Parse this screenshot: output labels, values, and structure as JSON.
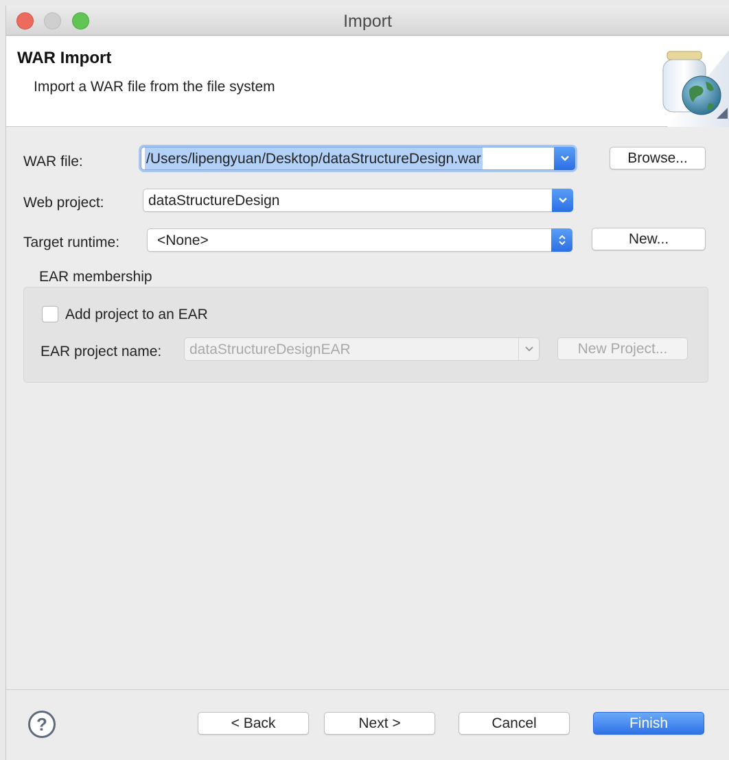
{
  "window": {
    "title": "Import",
    "controls": [
      "close",
      "minimize",
      "zoom"
    ]
  },
  "banner": {
    "title": "WAR Import",
    "description": "Import a WAR file from the file system",
    "icon": "jar-globe-icon"
  },
  "form": {
    "war_file": {
      "label": "WAR file:",
      "value": "/Users/lipengyuan/Desktop/dataStructureDesign.war",
      "browse_label": "Browse..."
    },
    "web_project": {
      "label": "Web project:",
      "value": "dataStructureDesign"
    },
    "target_runtime": {
      "label": "Target runtime:",
      "value": "<None>",
      "new_label": "New..."
    },
    "ear": {
      "group_label": "EAR membership",
      "checkbox_label": "Add project to an EAR",
      "checked": false,
      "project_name_label": "EAR project name:",
      "project_name_value": "dataStructureDesignEAR",
      "new_project_label": "New Project..."
    }
  },
  "footer": {
    "help_icon": "help-icon",
    "back_label": "< Back",
    "next_label": "Next >",
    "cancel_label": "Cancel",
    "finish_label": "Finish"
  },
  "colors": {
    "accent": "#2f72e8",
    "selection": "#b3d1f7",
    "close": "#ed6a5e",
    "zoom": "#61c554"
  }
}
